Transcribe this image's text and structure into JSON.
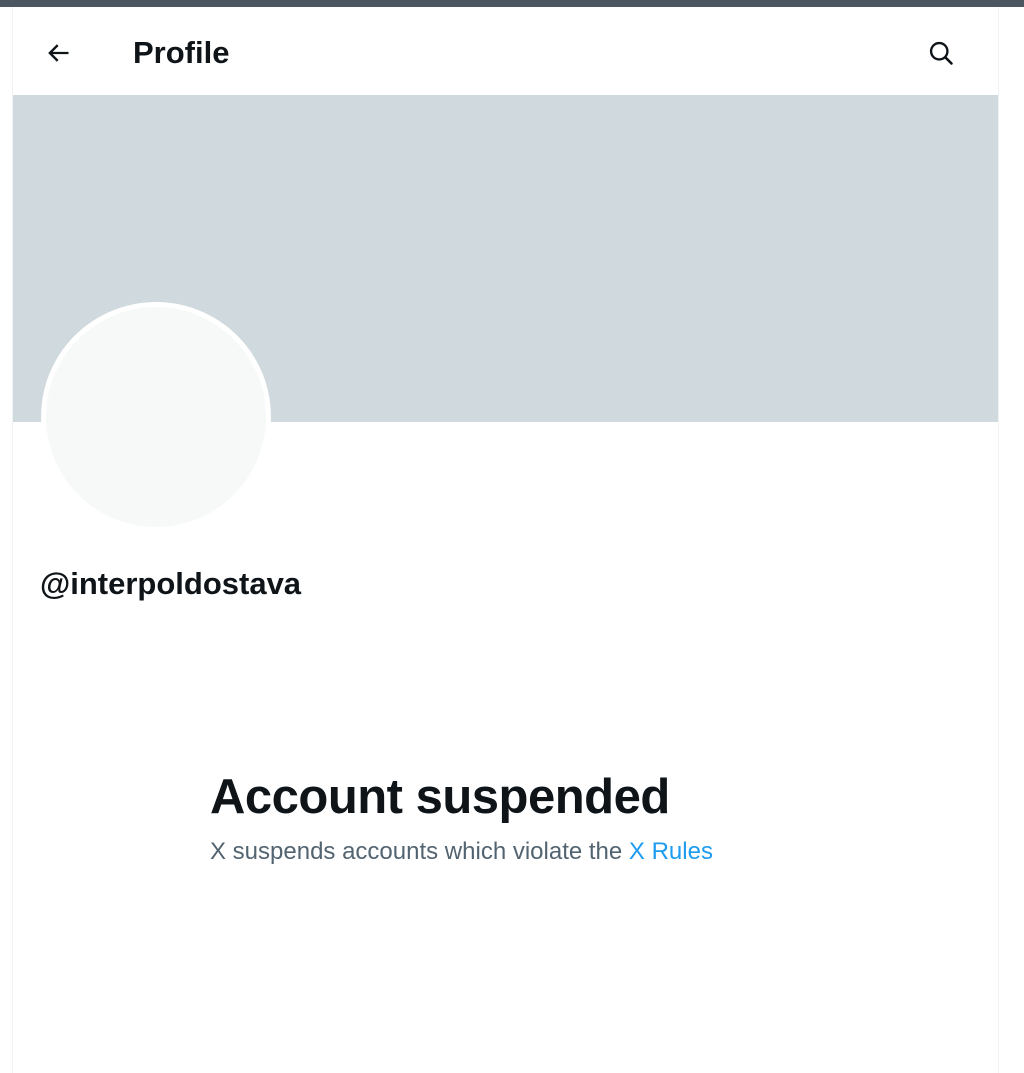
{
  "header": {
    "title": "Profile",
    "back_icon": "arrow-left-icon",
    "search_icon": "search-icon"
  },
  "profile": {
    "handle": "@interpoldostava"
  },
  "notice": {
    "title": "Account suspended",
    "text_prefix": "X suspends accounts which violate the ",
    "link_label": "X Rules"
  },
  "colors": {
    "banner": "#cfd9de",
    "avatar": "#f7f9f9",
    "link": "#1d9bf0",
    "secondary_text": "#536471",
    "primary_text": "#0f1419"
  }
}
